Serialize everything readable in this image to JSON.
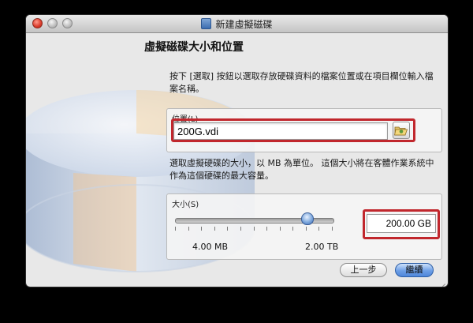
{
  "window": {
    "title": "新建虛擬磁碟"
  },
  "page": {
    "heading": "虛擬磁碟大小和位置",
    "location_description": "按下 [選取] 按鈕以選取存放硬碟資料的檔案位置或在項目欄位輸入檔案名稱。",
    "size_description": "選取虛擬硬碟的大小，以 MB 為單位。 這個大小將在客體作業系統中作為這個硬碟的最大容量。"
  },
  "location": {
    "label": "位置(L)",
    "value": "200G.vdi",
    "folder_icon": "folder-open-icon"
  },
  "size": {
    "label": "大小(S)",
    "value": "200.00 GB",
    "min_label": "4.00 MB",
    "max_label": "2.00 TB",
    "slider_position": 0.84
  },
  "buttons": {
    "back": "上一步",
    "next": "繼續"
  },
  "colors": {
    "highlight": "#c1272d",
    "accent": "#4f86da",
    "window_bg": "#e8e8e8"
  }
}
